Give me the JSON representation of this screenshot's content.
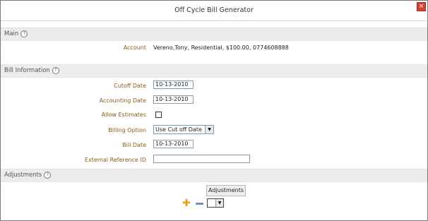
{
  "window": {
    "title": "Off Cycle Bill Generator",
    "close_symbol": "×"
  },
  "sections": {
    "main": {
      "title": "Main"
    },
    "bill_information": {
      "title": "Bill Information"
    },
    "adjustments": {
      "title": "Adjustments"
    }
  },
  "help_symbol": "?",
  "main": {
    "account_label": "Account",
    "account_value": "Vereno,Tony, Residential, $100.00, 0774608888"
  },
  "bill_information": {
    "cutoff_date_label": "Cutoff Date",
    "cutoff_date_value": "10-13-2010",
    "accounting_date_label": "Accounting Date",
    "accounting_date_value": "10-13-2010",
    "allow_estimates_label": "Allow Estimates",
    "allow_estimates_checked": false,
    "billing_option_label": "Billing Option",
    "billing_option_value": "Use Cut off Date",
    "bill_date_label": "Bill Date",
    "bill_date_value": "10-13-2010",
    "external_reference_label": "External Reference ID",
    "external_reference_value": ""
  },
  "adjustments": {
    "button_label": "Adjustments",
    "add_icon": "add-icon",
    "remove_icon": "remove-icon",
    "select_value": ""
  }
}
